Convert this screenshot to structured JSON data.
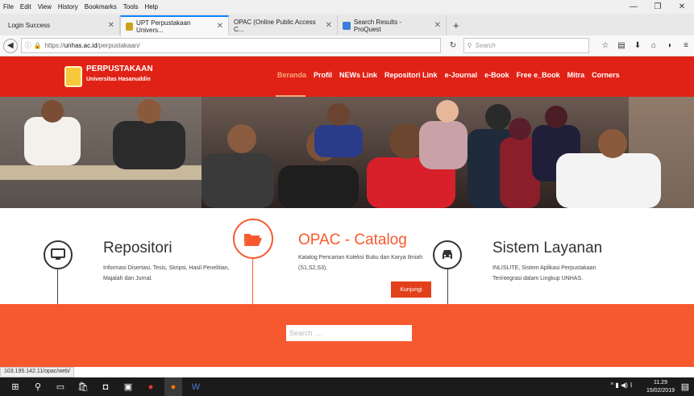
{
  "browser": {
    "menu": [
      "File",
      "Edit",
      "View",
      "History",
      "Bookmarks",
      "Tools",
      "Help"
    ],
    "tabs": [
      {
        "label": "Login Success",
        "active": false
      },
      {
        "label": "UPT Perpustakaan Univers...",
        "active": true
      },
      {
        "label": "OPAC (Online Public Access C...",
        "active": false
      },
      {
        "label": "Search Results - ProQuest",
        "active": false
      }
    ],
    "url_prefix": "https://",
    "url_domain": "unhas.ac.id",
    "url_path": "/perpustakaan/",
    "search_placeholder": "Search",
    "status_url": "103.195.142.11/opac/web/"
  },
  "site": {
    "brand_title": "PERPUSTAKAAN",
    "brand_subtitle": "Universitas Hasanuddin",
    "nav": [
      {
        "label": "Beranda",
        "active": true
      },
      {
        "label": "Profil"
      },
      {
        "label": "NEWs Link"
      },
      {
        "label": "Repositori Link"
      },
      {
        "label": "e-Journal"
      },
      {
        "label": "e-Book"
      },
      {
        "label": "Free e_Book"
      },
      {
        "label": "Mitra"
      },
      {
        "label": "Corners"
      }
    ],
    "accent": "#e02216",
    "orange": "#f7592f"
  },
  "features": {
    "repositori": {
      "title": "Repositori",
      "text": "Informasi Disertasi, Tesis, Skripsi, Hasil Penelitian, Majalah dan Jurnal."
    },
    "opac": {
      "title": "OPAC - Catalog",
      "text": "Katalog Pencarian Koleksi Buku dan Karya Ilmiah (S1,S2,S3),",
      "button": "Kunjungi"
    },
    "layanan": {
      "title": "Sistem Layanan",
      "text": "INLISLITE, Sistem Aplikasi Perpustakaan Terintegrasi dalam Lingkup UNHAS."
    }
  },
  "site_search_placeholder": "Search ....",
  "taskbar": {
    "time": "11.29",
    "date": "15/02/2019"
  }
}
